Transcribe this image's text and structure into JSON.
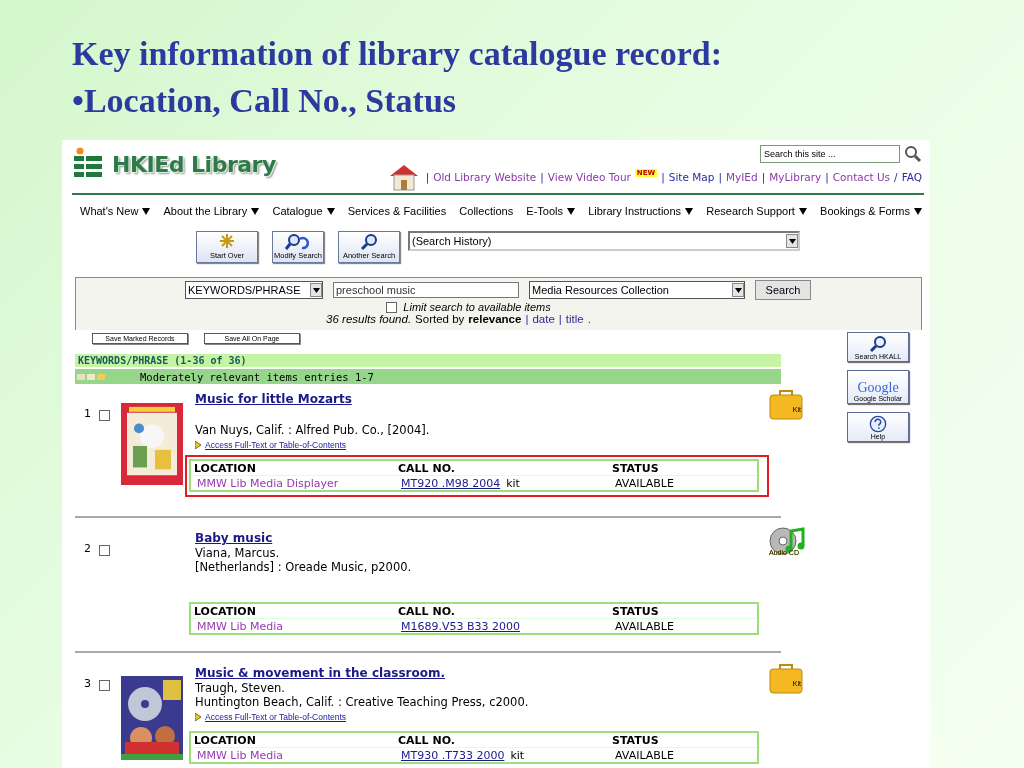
{
  "slide_title": [
    "Key information of library catalogue record:",
    "•Location, Call No., Status"
  ],
  "site": {
    "logo": "HKIEd Library",
    "search": {
      "placeholder": "Search this site ..."
    },
    "top_links": [
      {
        "separator": "|",
        "label": "Old Library Website",
        "visited": true
      },
      {
        "separator": "|",
        "label": "View Video Tour",
        "visited": true,
        "badge": "NEW"
      },
      {
        "separator": "|",
        "label": "Site Map",
        "visited": false
      },
      {
        "separator": "|",
        "label": "MyIEd",
        "visited": true
      },
      {
        "separator": "|",
        "label": "MyLibrary",
        "visited": true
      },
      {
        "separator": "|",
        "label": "Contact Us",
        "visited": true
      },
      {
        "separator": "/",
        "label": "FAQ",
        "visited": false
      }
    ],
    "nav": [
      {
        "label": "What's New",
        "dropdown": true
      },
      {
        "label": "About the Library",
        "dropdown": true
      },
      {
        "label": "Catalogue",
        "dropdown": true
      },
      {
        "label": "Services & Facilities",
        "dropdown": false
      },
      {
        "label": "Collections",
        "dropdown": false
      },
      {
        "label": "E-Tools",
        "dropdown": true
      },
      {
        "label": "Library Instructions",
        "dropdown": true
      },
      {
        "label": "Research Support",
        "dropdown": true
      },
      {
        "label": "Bookings & Forms",
        "dropdown": true
      }
    ]
  },
  "toolbar": {
    "buttons": [
      {
        "kind": "start",
        "label": "Start Over"
      },
      {
        "kind": "modify",
        "label": "Modify Search"
      },
      {
        "kind": "another",
        "label": "Another Search"
      }
    ],
    "history": "(Search History)"
  },
  "search_form": {
    "field": "KEYWORDS/PHRASE",
    "query": "preschool music",
    "collection": "Media Resources Collection",
    "button": "Search",
    "limit": {
      "label": "Limit search to available items",
      "checked": false
    },
    "results": "36 results found.",
    "sort_label": "Sorted by",
    "sort_options": [
      {
        "label": "relevance",
        "selected": true
      },
      {
        "label": "date",
        "selected": false,
        "separator": "|"
      },
      {
        "label": "title",
        "selected": false,
        "separator": "|"
      }
    ],
    "sort_end": "."
  },
  "save_buttons": [
    "Save Marked Records",
    "Save All On Page"
  ],
  "heading": "KEYWORDS/PHRASE (1-36 of 36)",
  "group": "Moderately relevant items entries 1-7",
  "records": [
    {
      "number": "1",
      "checked": false,
      "title": "Music for little Mozarts",
      "imprint": "Van Nuys, Calif. : Alfred Pub. Co., [2004].",
      "access_link": "Access Full-Text or Table-of-Contents",
      "highlighted": true,
      "format": {
        "kind": "kit",
        "label": "Kit"
      },
      "columns": [
        "LOCATION",
        "CALL NO.",
        "STATUS"
      ],
      "location": "MMW Lib Media Displayer",
      "call_no": "MT920 .M98 2004",
      "note": "kit",
      "status": "AVAILABLE"
    },
    {
      "number": "2",
      "checked": false,
      "title": "Baby music",
      "author": "Viana, Marcus.",
      "imprint": "[Netherlands] : Oreade Music, p2000.",
      "highlighted": false,
      "format": {
        "kind": "audio-cd",
        "label": "Audio CD"
      },
      "columns": [
        "LOCATION",
        "CALL NO.",
        "STATUS"
      ],
      "location": "MMW Lib Media",
      "call_no": "M1689.V53 B33 2000",
      "status": "AVAILABLE"
    },
    {
      "number": "3",
      "checked": false,
      "title": "Music & movement in the classroom.",
      "author": "Traugh, Steven.",
      "imprint": "Huntington Beach, Calif. : Creative Teaching Press, c2000.",
      "access_link": "Access Full-Text or Table-of-Contents",
      "highlighted": false,
      "format": {
        "kind": "kit",
        "label": "Kit"
      },
      "columns": [
        "LOCATION",
        "CALL NO.",
        "STATUS"
      ],
      "location": "MMW Lib Media",
      "call_no": "MT930 .T733 2000",
      "note": "kit",
      "status": "AVAILABLE"
    }
  ],
  "side_buttons": [
    {
      "kind": "search",
      "label": "Search HKALL"
    },
    {
      "kind": "google",
      "label": "Google Scholar",
      "logo": "Google"
    },
    {
      "kind": "help",
      "label": "Help"
    }
  ]
}
